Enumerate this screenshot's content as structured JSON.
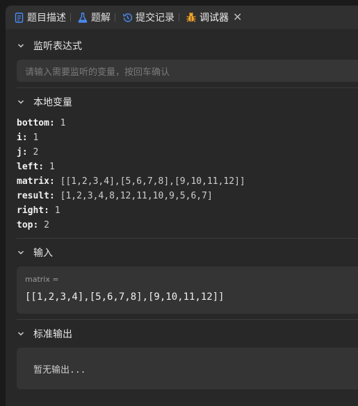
{
  "tabs": [
    {
      "label": "题目描述",
      "icon": "document-icon",
      "color": "#4a8cf7"
    },
    {
      "label": "题解",
      "icon": "flask-icon",
      "color": "#4a8cf7"
    },
    {
      "label": "提交记录",
      "icon": "history-icon",
      "color": "#4a8cf7"
    },
    {
      "label": "调试器",
      "icon": "bug-icon",
      "color": "#f5a623",
      "active": true
    }
  ],
  "close_glyph": "✕",
  "watch": {
    "title": "监听表达式",
    "placeholder": "请输入需要监听的变量，按回车确认"
  },
  "locals": {
    "title": "本地变量",
    "vars": [
      {
        "name": "bottom:",
        "value": "1"
      },
      {
        "name": "i:",
        "value": "1"
      },
      {
        "name": "j:",
        "value": "2"
      },
      {
        "name": "left:",
        "value": "1"
      },
      {
        "name": "matrix:",
        "value": "[[1,2,3,4],[5,6,7,8],[9,10,11,12]]"
      },
      {
        "name": "result:",
        "value": "[1,2,3,4,8,12,11,10,9,5,6,7]"
      },
      {
        "name": "right:",
        "value": "1"
      },
      {
        "name": "top:",
        "value": "2"
      }
    ]
  },
  "input": {
    "title": "输入",
    "label": "matrix =",
    "value": "[[1,2,3,4],[5,6,7,8],[9,10,11,12]]"
  },
  "output": {
    "title": "标准输出",
    "value": "暂无输出..."
  }
}
